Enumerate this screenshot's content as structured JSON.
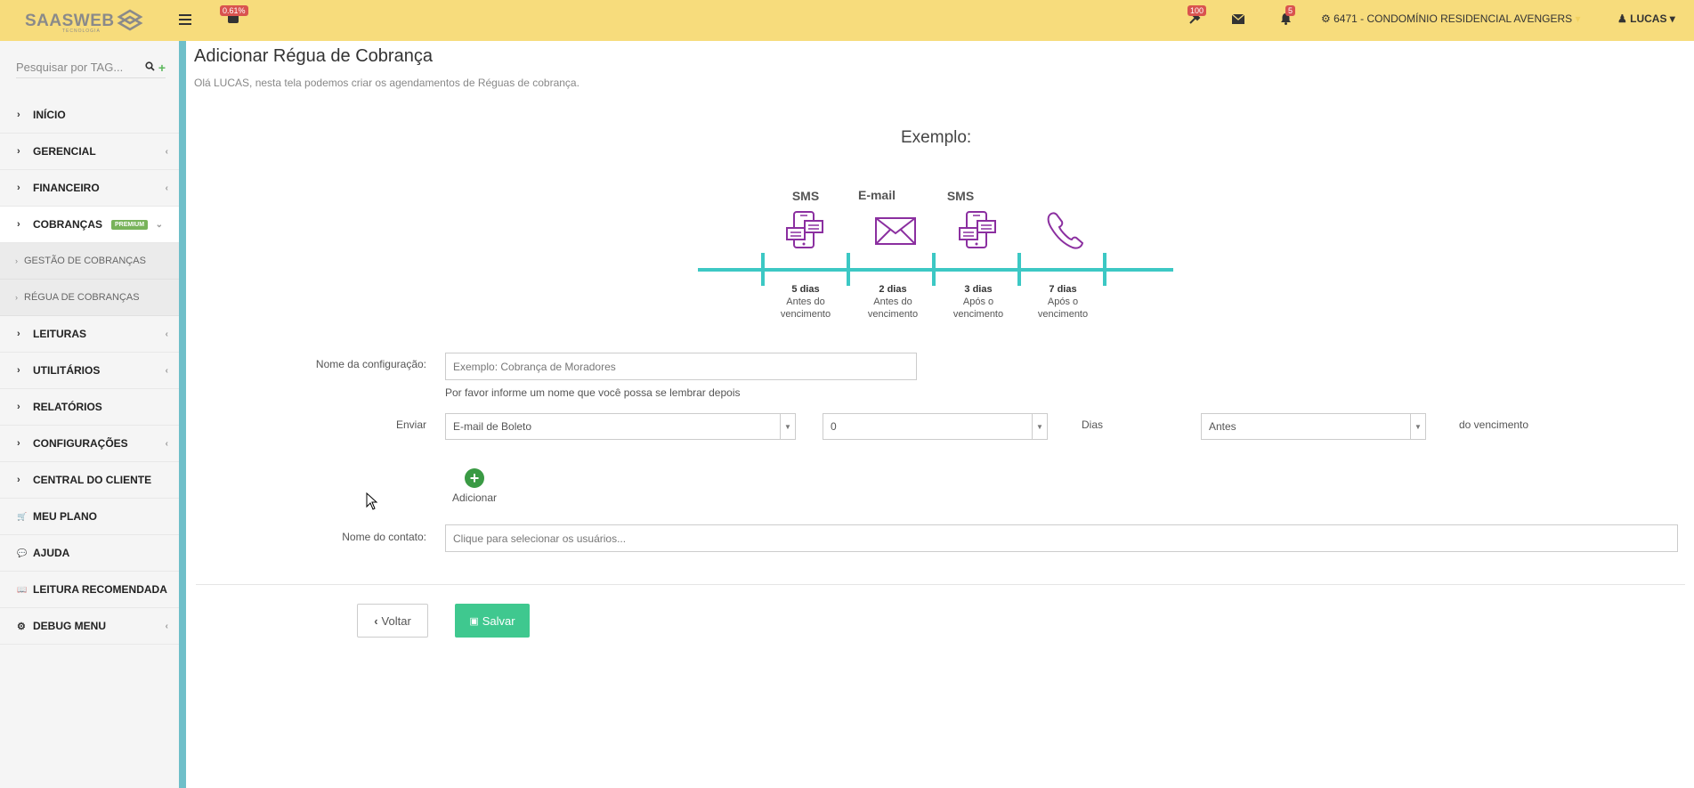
{
  "header": {
    "logo": "SAASWEB",
    "logo_sub": "TECNOLOGIA",
    "cart_badge": "0.61%",
    "tools_badge": "100",
    "bell_badge": "5",
    "condo": "6471 - CONDOMÍNIO RESIDENCIAL AVENGERS",
    "user": "LUCAS"
  },
  "sidebar": {
    "search_placeholder": "Pesquisar por TAG...",
    "items": [
      {
        "label": "INÍCIO"
      },
      {
        "label": "GERENCIAL"
      },
      {
        "label": "FINANCEIRO"
      },
      {
        "label": "COBRANÇAS",
        "badge": "PREMIUM"
      },
      {
        "label": "GESTÃO DE COBRANÇAS"
      },
      {
        "label": "RÉGUA DE COBRANÇAS"
      },
      {
        "label": "LEITURAS"
      },
      {
        "label": "UTILITÁRIOS"
      },
      {
        "label": "RELATÓRIOS"
      },
      {
        "label": "CONFIGURAÇÕES"
      },
      {
        "label": "CENTRAL DO CLIENTE"
      },
      {
        "label": "MEU PLANO"
      },
      {
        "label": "AJUDA"
      },
      {
        "label": "LEITURA RECOMENDADA"
      },
      {
        "label": "DEBUG MENU"
      }
    ]
  },
  "page": {
    "title": "Adicionar Régua de Cobrança",
    "subtitle": "Olá LUCAS, nesta tela podemos criar os agendamentos de Réguas de cobrança.",
    "example_title": "Exemplo:"
  },
  "timeline": {
    "color": "#3cc8c4",
    "icon_color": "#8b2fa0",
    "steps": [
      {
        "label": "SMS",
        "icon": "phone-sms-icon",
        "days": "5 dias",
        "line1": "Antes do",
        "line2": "vencimento"
      },
      {
        "label": "E-mail",
        "icon": "envelope-icon",
        "days": "2 dias",
        "line1": "Antes do",
        "line2": "vencimento"
      },
      {
        "label": "SMS",
        "icon": "phone-sms-icon",
        "days": "3 dias",
        "line1": "Após o",
        "line2": "vencimento"
      },
      {
        "label": "",
        "icon": "telephone-icon",
        "days": "7 dias",
        "line1": "Após o",
        "line2": "vencimento"
      }
    ]
  },
  "form": {
    "name_label": "Nome da configuração:",
    "name_placeholder": "Exemplo: Cobrança de Moradores",
    "name_help": "Por favor informe um nome que você possa se lembrar depois",
    "send_label": "Enviar",
    "send_value": "E-mail de Boleto",
    "days_value": "0",
    "days_label": "Dias",
    "when_value": "Antes",
    "due_label": "do vencimento",
    "add_label": "Adicionar",
    "contact_label": "Nome do contato:",
    "contact_placeholder": "Clique para selecionar os usuários...",
    "back_label": "Voltar",
    "save_label": "Salvar"
  }
}
